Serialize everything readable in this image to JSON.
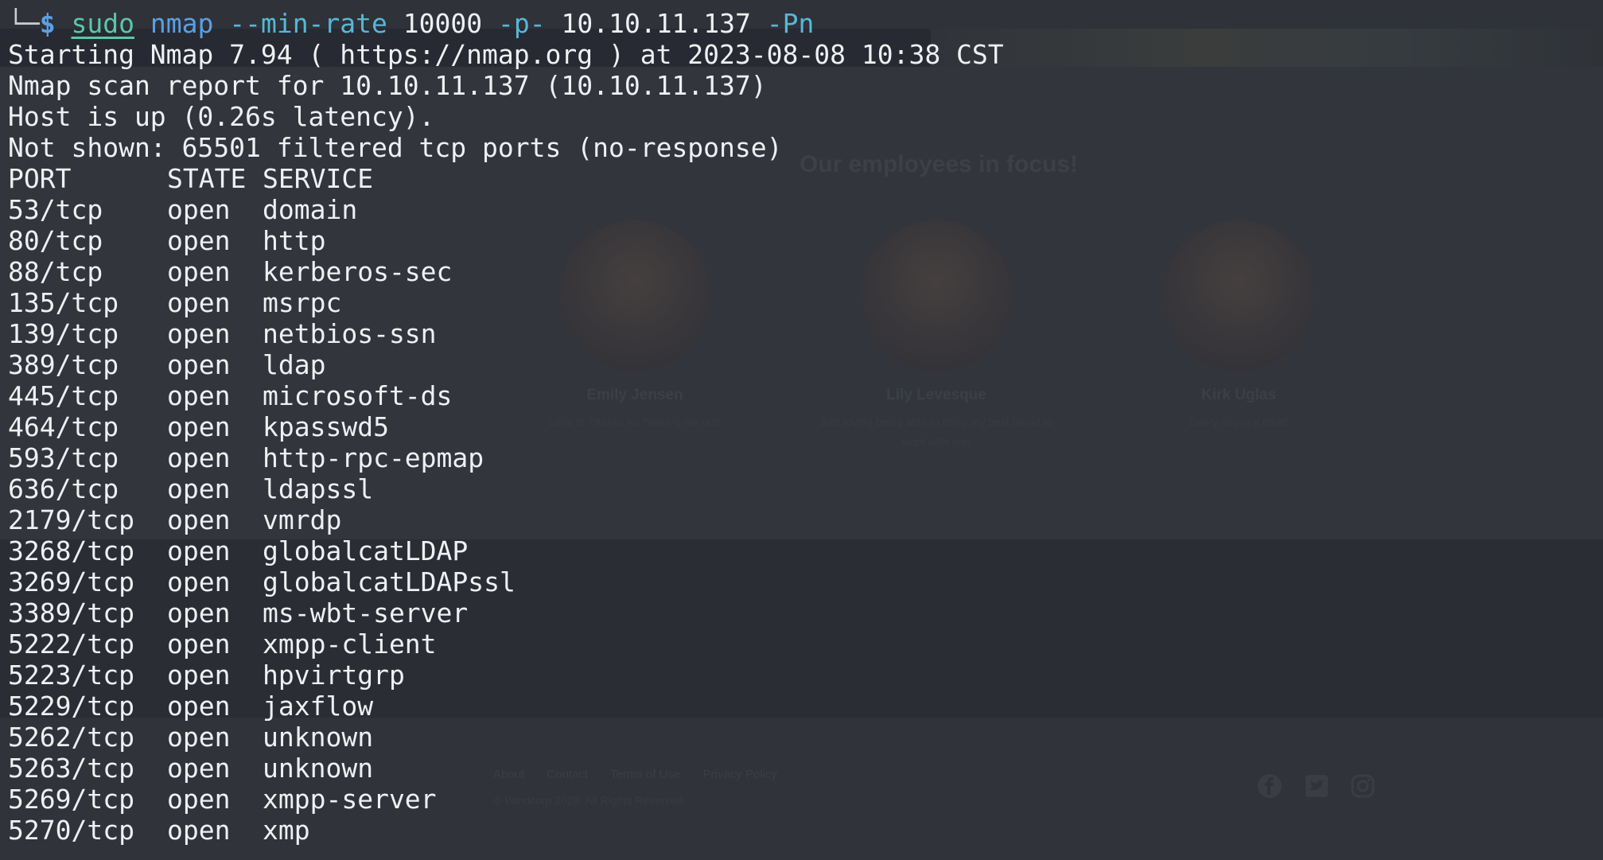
{
  "terminal": {
    "prompt": {
      "corner": "└─",
      "symbol": "$",
      "sudo": "sudo",
      "program": "nmap",
      "flag_min_rate": "--min-rate",
      "min_rate_value": "10000",
      "flag_ports": "-p-",
      "target": "10.10.11.137",
      "flag_pn": "-Pn"
    },
    "header_lines": [
      "Starting Nmap 7.94 ( https://nmap.org ) at 2023-08-08 10:38 CST",
      "Nmap scan report for 10.10.11.137 (10.10.11.137)",
      "Host is up (0.26s latency).",
      "Not shown: 65501 filtered tcp ports (no-response)"
    ],
    "columns": {
      "port": "PORT",
      "state": "STATE",
      "service": "SERVICE"
    },
    "ports": [
      {
        "port": "53/tcp",
        "state": "open",
        "service": "domain"
      },
      {
        "port": "80/tcp",
        "state": "open",
        "service": "http"
      },
      {
        "port": "88/tcp",
        "state": "open",
        "service": "kerberos-sec"
      },
      {
        "port": "135/tcp",
        "state": "open",
        "service": "msrpc"
      },
      {
        "port": "139/tcp",
        "state": "open",
        "service": "netbios-ssn"
      },
      {
        "port": "389/tcp",
        "state": "open",
        "service": "ldap"
      },
      {
        "port": "445/tcp",
        "state": "open",
        "service": "microsoft-ds"
      },
      {
        "port": "464/tcp",
        "state": "open",
        "service": "kpasswd5"
      },
      {
        "port": "593/tcp",
        "state": "open",
        "service": "http-rpc-epmap"
      },
      {
        "port": "636/tcp",
        "state": "open",
        "service": "ldapssl"
      },
      {
        "port": "2179/tcp",
        "state": "open",
        "service": "vmrdp"
      },
      {
        "port": "3268/tcp",
        "state": "open",
        "service": "globalcatLDAP"
      },
      {
        "port": "3269/tcp",
        "state": "open",
        "service": "globalcatLDAPssl"
      },
      {
        "port": "3389/tcp",
        "state": "open",
        "service": "ms-wbt-server"
      },
      {
        "port": "5222/tcp",
        "state": "open",
        "service": "xmpp-client"
      },
      {
        "port": "5223/tcp",
        "state": "open",
        "service": "hpvirtgrp"
      },
      {
        "port": "5229/tcp",
        "state": "open",
        "service": "jaxflow"
      },
      {
        "port": "5262/tcp",
        "state": "open",
        "service": "unknown"
      },
      {
        "port": "5263/tcp",
        "state": "open",
        "service": "unknown"
      },
      {
        "port": "5269/tcp",
        "state": "open",
        "service": "xmpp-server"
      },
      {
        "port": "5270/tcp",
        "state": "open",
        "service": "xmp"
      }
    ]
  },
  "background_page": {
    "heading": "Our employees in focus!",
    "employees": [
      {
        "name": "Emily Jensen",
        "quote_lines": [
          "Love it! Thanks for hearing me out!"
        ]
      },
      {
        "name": "Lily Levesque",
        "quote_lines": [
          "Just loving being able to bring my best friend to",
          "work with me!"
        ]
      },
      {
        "name": "Kirk Uglas",
        "quote_lines": [
          "Every day is a treat!"
        ]
      }
    ],
    "footer_links": [
      "About",
      "Contact",
      "Terms of Use",
      "Privacy Policy"
    ],
    "copyright": "© Windcorp 2020. All Rights Reserved.",
    "social_icons": [
      "facebook-icon",
      "twitter-icon",
      "instagram-icon"
    ]
  },
  "colors": {
    "terminal_bg": "#272a33",
    "text": "#eef0f2",
    "prompt_blue": "#5aa0e6",
    "command_green": "#5ac8a8"
  }
}
